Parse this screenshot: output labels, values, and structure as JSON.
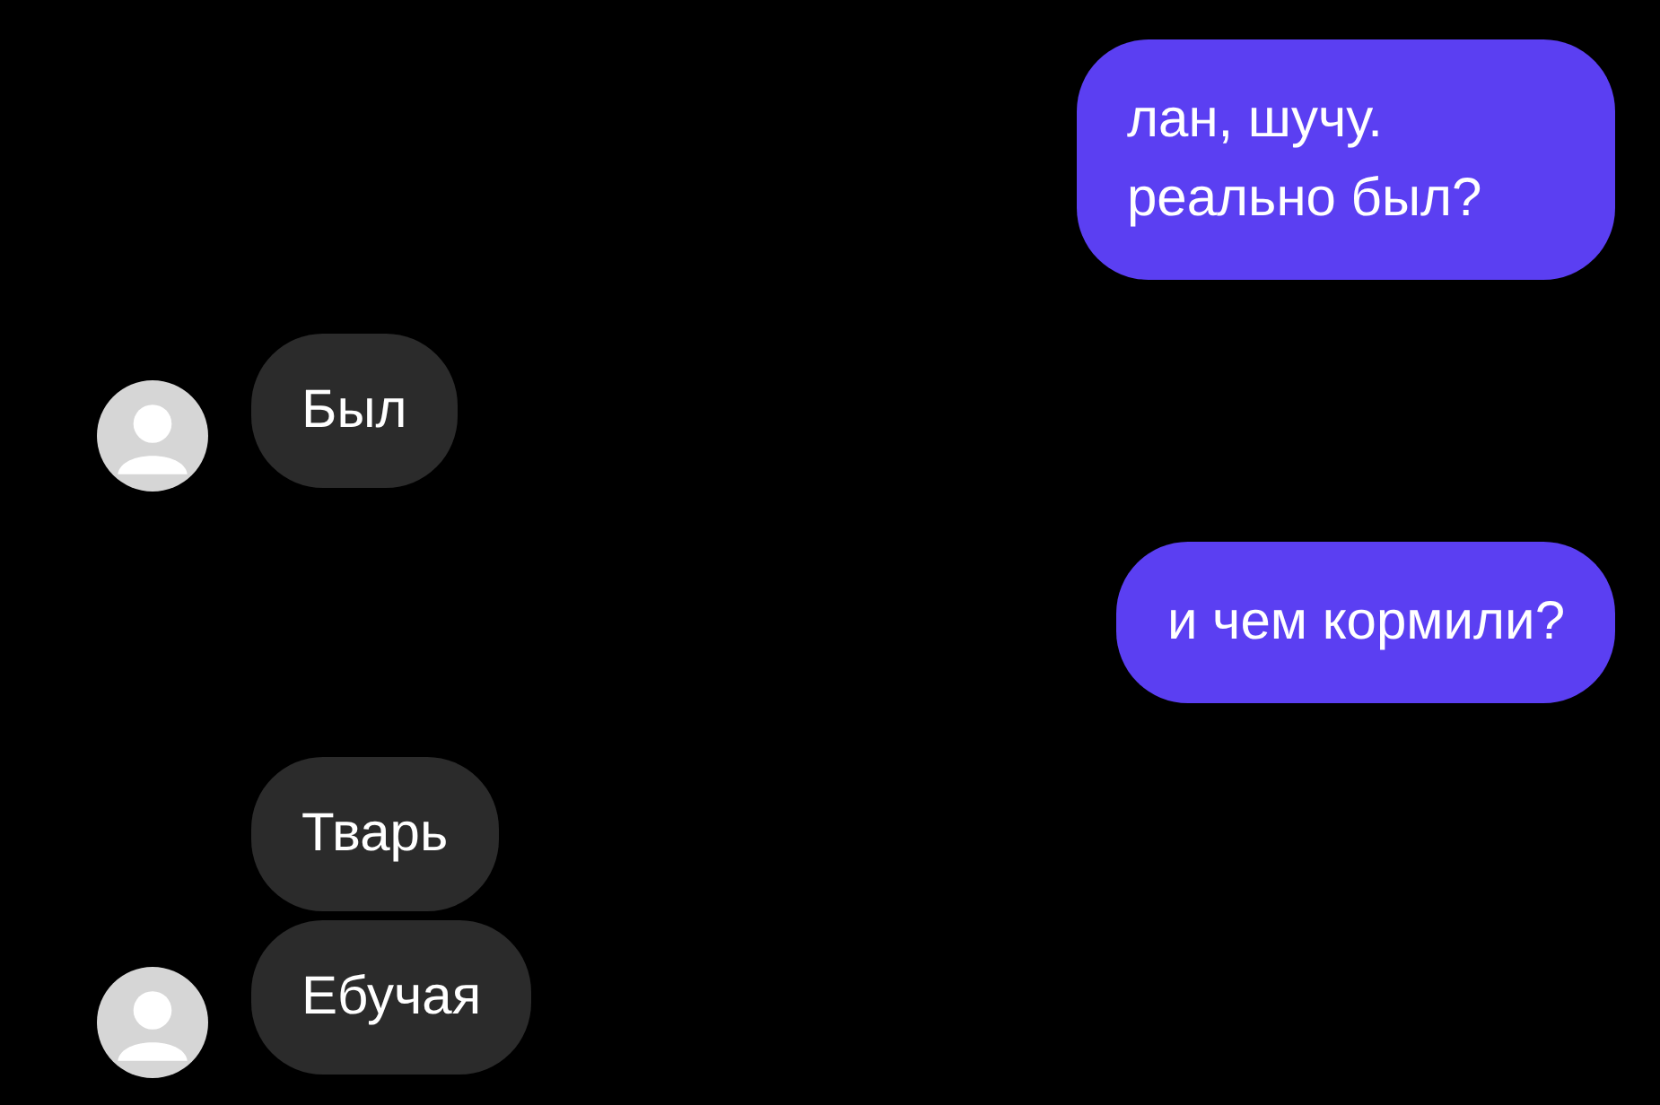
{
  "messages": [
    {
      "kind": "outgoing",
      "text": "лан, шучу. реально был?"
    },
    {
      "kind": "incoming",
      "text": "Был",
      "avatar": true
    },
    {
      "kind": "outgoing",
      "text": "и чем кормили?"
    },
    {
      "kind": "incoming",
      "text": "Тварь",
      "avatar": false
    },
    {
      "kind": "incoming",
      "text": "Ебучая",
      "avatar": true
    }
  ]
}
